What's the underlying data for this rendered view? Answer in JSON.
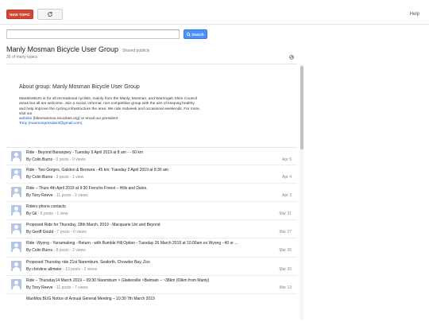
{
  "toolbar": {
    "new_topic_label": "NEW TOPIC",
    "help_label": "Help"
  },
  "search": {
    "value": "",
    "button_label": "Search"
  },
  "group": {
    "title": "Manly Mosman Bicycle User Group",
    "visibility": "Shared publicly",
    "topic_count": "30 of many topics"
  },
  "about": {
    "title": "About group: Manly Mosman Bicycle User Group",
    "description": "ManMosBUG is for all recreational cyclists, mainly from the Manly, Mosman, and Warringah Shire Council areas but all are welcome. Join a social, informal, non-competitive group with the aim of keeping healthy and help improve the cycling infrastructure the area. We ride midweek and occasional weekends. For more, visit our",
    "website_label": "website",
    "website_url": "(bikemanmos.neocities.org) or email our president",
    "president": "Tony (manmospresident@gmail.com)"
  },
  "topics": [
    {
      "title": "Ride - Beyond Bananjoey - Tuesday 9 April 2019 at 8 am - - 60 km",
      "author": "By Colin Burns",
      "stats": "- 0 posts - 0 views",
      "date": "Apr 5"
    },
    {
      "title": "Ride - Two Gorges, Galston & Berowra - 45 km: Tuesday 2 April 2019 at 8:30 am",
      "author": "By Colin Burns",
      "stats": "- 3 posts - 1 view",
      "date": "Apr 4"
    },
    {
      "title": "Ride – Thurs 4th April 2019 at 9:30 Frenchs Forest – Hills and Dales.",
      "author": "By Tony Reeve",
      "stats": "- 11 posts - 2 views",
      "date": "Apr 3"
    },
    {
      "title": "Riders phone contacts",
      "author": "By Gil",
      "stats": "- 6 posts - 1 view",
      "date": "Mar 31"
    },
    {
      "title": "Proposed Ride for Thursday, 28th March, 2019 - Macquarie Uni and Beyond",
      "author": "By Geoff Gould",
      "stats": "- 7 posts - 0 views",
      "date": "Mar 27"
    },
    {
      "title": "Ride -Wyong - Yarramalong - Return - with Bumble Hill Option - Tuesday 26 March 2019 at 10.00am ex Wyong - 40 or ...",
      "author": "By Colin Burns",
      "stats": "- 8 posts - 2 views",
      "date": "Mar 26"
    },
    {
      "title": "Proposed Thursday ride 21st Narembum, Seaforth, Chowder Bay, Zoo",
      "author": "By christine allmeier",
      "stats": "- 13 posts - 2 views",
      "date": "Mar 20"
    },
    {
      "title": "Ride – Thursday14 March 2019 – 09:30 Narembum > Gladesville >Balmain – ~38km (69km from Manly)",
      "author": "By Tony Reeve",
      "stats": "- 11 posts - 7 views",
      "date": "Mar 13"
    },
    {
      "title": "ManMos BUG Notice of Annual General Meeting – 10:30 7th March 2019",
      "author": "",
      "stats": "",
      "date": ""
    }
  ]
}
